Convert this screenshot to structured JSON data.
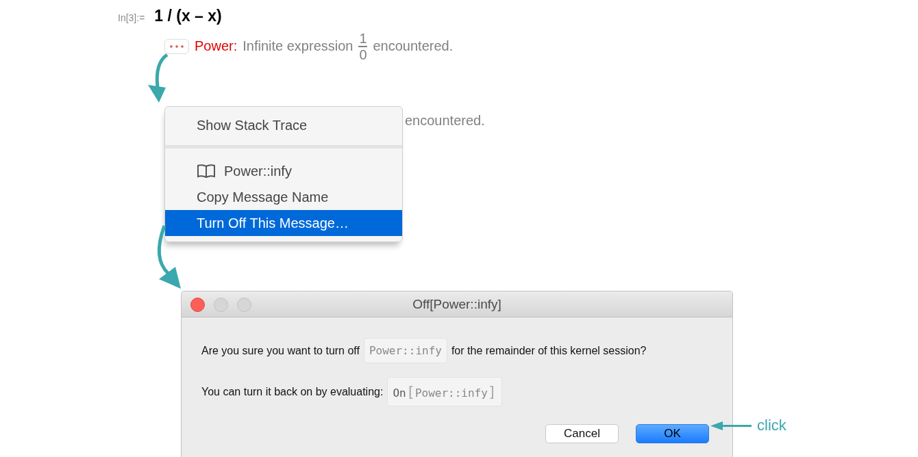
{
  "notebook": {
    "input_label": "In[3]:=",
    "input": "1 / (x – x)",
    "message": {
      "tag": "Power:",
      "text": "Infinite expression",
      "numerator": "1",
      "denominator": "0",
      "end": "encountered."
    },
    "covered_message": {
      "end": "encountered."
    }
  },
  "context_menu": {
    "groups": [
      [
        {
          "label": "Show Stack Trace",
          "kind": "plain",
          "selected": false
        }
      ],
      [
        {
          "label": "Power::infy",
          "kind": "doc-link",
          "selected": false
        },
        {
          "label": "Copy Message Name",
          "kind": "plain",
          "selected": false
        },
        {
          "label": "Turn Off This Message…",
          "kind": "plain",
          "selected": true
        }
      ]
    ]
  },
  "dialog": {
    "title": "Off[Power::infy]",
    "question": {
      "before": "Are you sure you want to turn off",
      "code": "Power::infy",
      "after": "for the remainder of this kernel session?"
    },
    "hint": {
      "text": "You can turn it back on by evaluating:",
      "head": "On",
      "open": "[",
      "arg": "Power::infy",
      "close": "]"
    },
    "buttons": [
      {
        "label": "Cancel",
        "default": false
      },
      {
        "label": "OK",
        "default": true
      }
    ]
  },
  "annotation": {
    "text": "click"
  }
}
